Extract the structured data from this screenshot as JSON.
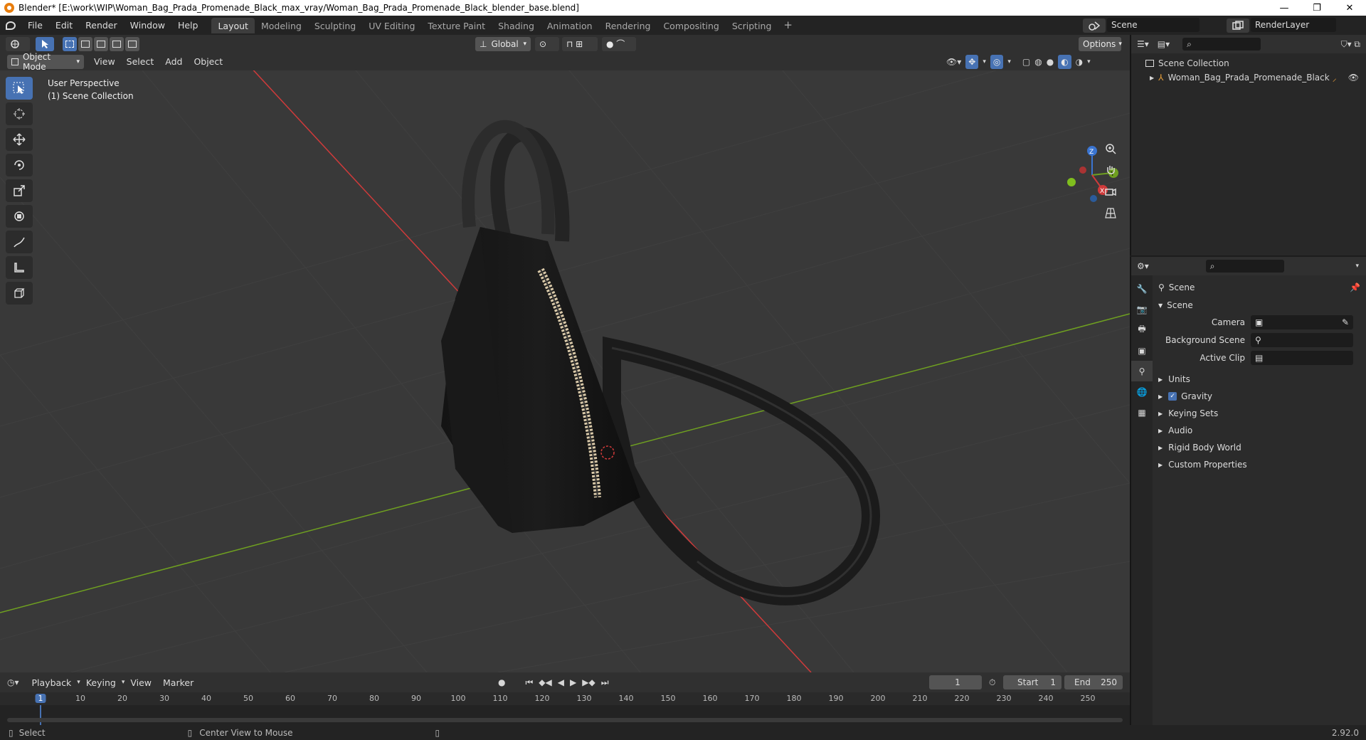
{
  "window": {
    "title": "Blender* [E:\\work\\WIP\\Woman_Bag_Prada_Promenade_Black_max_vray/Woman_Bag_Prada_Promenade_Black_blender_base.blend]",
    "minimize": "—",
    "maximize": "❐",
    "close": "✕"
  },
  "menu": [
    "File",
    "Edit",
    "Render",
    "Window",
    "Help"
  ],
  "workspaces": [
    "Layout",
    "Modeling",
    "Sculpting",
    "UV Editing",
    "Texture Paint",
    "Shading",
    "Animation",
    "Rendering",
    "Compositing",
    "Scripting"
  ],
  "workspace_add": "+",
  "scene": {
    "name": "Scene",
    "view_layer": "RenderLayer"
  },
  "viewport": {
    "mode": "Object Mode",
    "menus": [
      "View",
      "Select",
      "Add",
      "Object"
    ],
    "transform_orientation": "Global",
    "options": "Options",
    "perspective": "User Perspective",
    "collection": "(1) Scene Collection",
    "gizmo": {
      "x": "X",
      "y": "Y",
      "z": "Z"
    }
  },
  "outliner": {
    "root": "Scene Collection",
    "items": [
      {
        "label": "Woman_Bag_Prada_Promenade_Black"
      }
    ]
  },
  "properties": {
    "context": "Scene",
    "panel": "Scene",
    "fields": [
      {
        "label": "Camera",
        "value": ""
      },
      {
        "label": "Background Scene",
        "value": ""
      },
      {
        "label": "Active Clip",
        "value": ""
      }
    ],
    "sections": [
      {
        "label": "Units"
      },
      {
        "label": "Gravity",
        "checked": true
      },
      {
        "label": "Keying Sets"
      },
      {
        "label": "Audio"
      },
      {
        "label": "Rigid Body World"
      },
      {
        "label": "Custom Properties"
      }
    ]
  },
  "timeline": {
    "menus": [
      "Playback",
      "Keying",
      "View",
      "Marker"
    ],
    "current_frame": "1",
    "start_label": "Start",
    "start": "1",
    "end_label": "End",
    "end": "250",
    "ruler": [
      "1",
      "10",
      "20",
      "30",
      "40",
      "50",
      "60",
      "70",
      "80",
      "90",
      "100",
      "110",
      "120",
      "130",
      "140",
      "150",
      "160",
      "170",
      "180",
      "190",
      "200",
      "210",
      "220",
      "230",
      "240",
      "250"
    ]
  },
  "status": {
    "left": "Select",
    "middle": "Center View to Mouse",
    "version": "2.92.0"
  },
  "colors": {
    "accent": "#4772b3",
    "x_axis": "#d03a3a",
    "y_axis": "#6fa020",
    "z_axis": "#3a74d0",
    "header": "#303030",
    "viewport": "#393939"
  }
}
